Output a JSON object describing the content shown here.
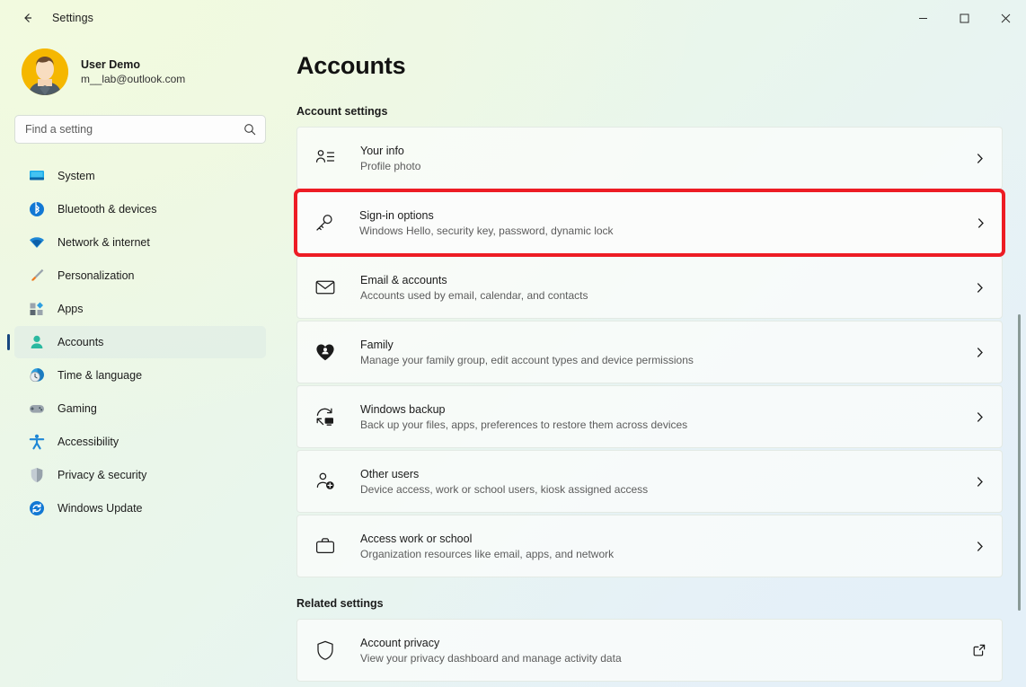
{
  "window": {
    "app_title": "Settings",
    "back_icon": "arrow-left-icon",
    "controls": [
      {
        "name": "minimize",
        "icon": "minimize-icon"
      },
      {
        "name": "maximize",
        "icon": "maximize-icon"
      },
      {
        "name": "close",
        "icon": "close-icon"
      }
    ]
  },
  "accent_colors": {
    "highlight_red": "#ed1c24",
    "selection_bar": "#16467f",
    "avatar_bg": "#f5b700",
    "accounts_icon": "#2bb9a0"
  },
  "sidebar": {
    "profile": {
      "name": "User Demo",
      "email": "m__lab@outlook.com",
      "avatar": "user-avatar"
    },
    "search": {
      "placeholder": "Find a setting",
      "value": "",
      "icon": "search-icon"
    },
    "items": [
      {
        "label": "System",
        "icon": "system-icon",
        "selected": false
      },
      {
        "label": "Bluetooth & devices",
        "icon": "bluetooth-icon",
        "selected": false
      },
      {
        "label": "Network & internet",
        "icon": "wifi-icon",
        "selected": false
      },
      {
        "label": "Personalization",
        "icon": "paintbrush-icon",
        "selected": false
      },
      {
        "label": "Apps",
        "icon": "apps-icon",
        "selected": false
      },
      {
        "label": "Accounts",
        "icon": "person-icon",
        "selected": true
      },
      {
        "label": "Time & language",
        "icon": "clock-icon",
        "selected": false
      },
      {
        "label": "Gaming",
        "icon": "gamepad-icon",
        "selected": false
      },
      {
        "label": "Accessibility",
        "icon": "accessibility-icon",
        "selected": false
      },
      {
        "label": "Privacy & security",
        "icon": "shield-icon",
        "selected": false
      },
      {
        "label": "Windows Update",
        "icon": "update-icon",
        "selected": false
      }
    ]
  },
  "main": {
    "page_title": "Accounts",
    "account_settings_heading": "Account settings",
    "related_settings_heading": "Related settings",
    "account_settings": [
      {
        "title": "Your info",
        "desc": "Profile photo",
        "icon": "your-info-icon",
        "chevron": "chevron-right-icon",
        "highlighted": false
      },
      {
        "title": "Sign-in options",
        "desc": "Windows Hello, security key, password, dynamic lock",
        "icon": "key-icon",
        "chevron": "chevron-right-icon",
        "highlighted": true
      },
      {
        "title": "Email & accounts",
        "desc": "Accounts used by email, calendar, and contacts",
        "icon": "mail-icon",
        "chevron": "chevron-right-icon",
        "highlighted": false
      },
      {
        "title": "Family",
        "desc": "Manage your family group, edit account types and device permissions",
        "icon": "family-heart-icon",
        "chevron": "chevron-right-icon",
        "highlighted": false
      },
      {
        "title": "Windows backup",
        "desc": "Back up your files, apps, preferences to restore them across devices",
        "icon": "backup-icon",
        "chevron": "chevron-right-icon",
        "highlighted": false
      },
      {
        "title": "Other users",
        "desc": "Device access, work or school users, kiosk assigned access",
        "icon": "add-user-icon",
        "chevron": "chevron-right-icon",
        "highlighted": false
      },
      {
        "title": "Access work or school",
        "desc": "Organization resources like email, apps, and network",
        "icon": "briefcase-icon",
        "chevron": "chevron-right-icon",
        "highlighted": false
      }
    ],
    "related_settings": [
      {
        "title": "Account privacy",
        "desc": "View your privacy dashboard and manage activity data",
        "icon": "shield-outline-icon",
        "chevron": "external-link-icon",
        "highlighted": false
      }
    ]
  }
}
